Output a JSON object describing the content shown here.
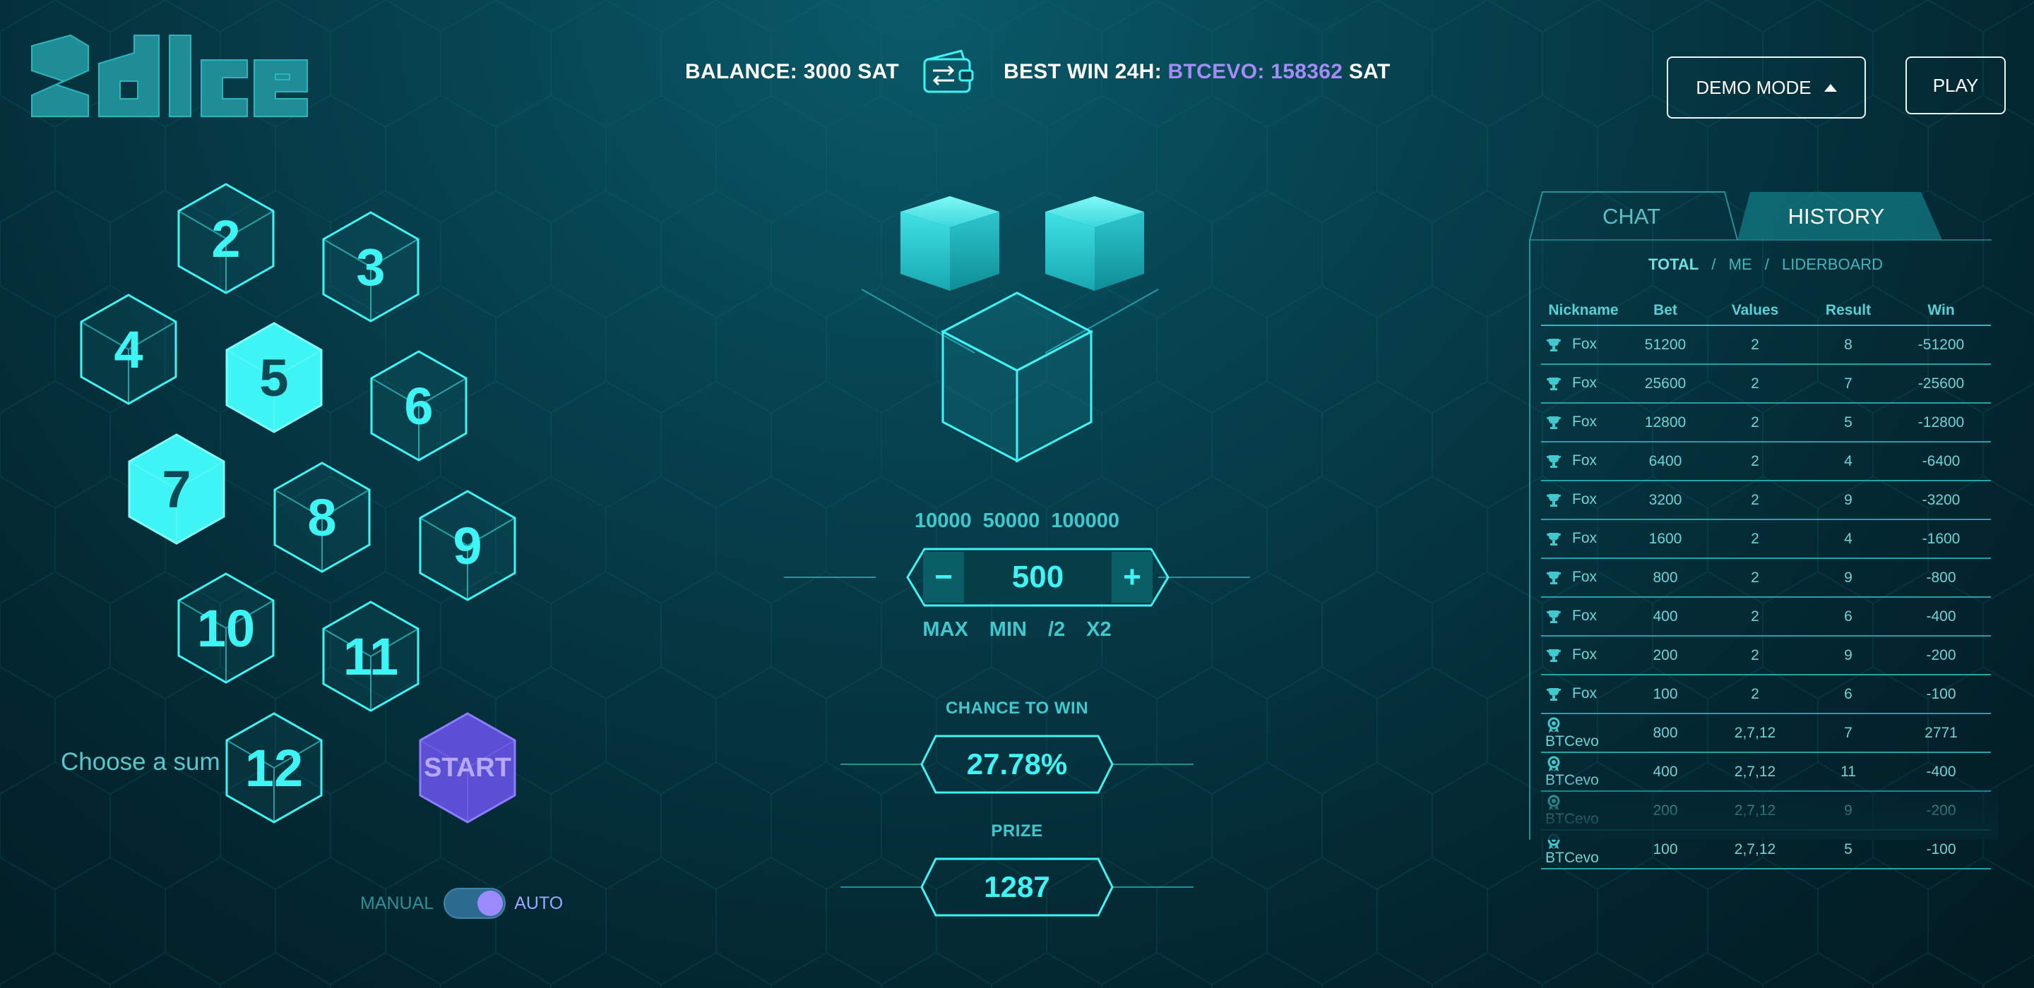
{
  "app": {
    "logo_text": "2dice"
  },
  "header": {
    "balance_label": "BALANCE:",
    "balance_value": "3000",
    "balance_unit": "SAT",
    "wallet_icon": "wallet-exchange-icon",
    "best_label": "BEST WIN 24H:",
    "best_user": "BTCEVO:",
    "best_value": "158362",
    "best_unit": "SAT",
    "demo_label": "DEMO MODE",
    "play_label": "PLAY"
  },
  "board": {
    "sums": [
      "2",
      "3",
      "4",
      "5",
      "6",
      "7",
      "8",
      "9",
      "10",
      "11",
      "12"
    ],
    "selected": [
      "5",
      "7"
    ],
    "start_label": "START",
    "choose_label": "Choose a sum",
    "toggle": {
      "left": "MANUAL",
      "right": "AUTO",
      "value": "AUTO"
    }
  },
  "bet": {
    "presets": [
      "10000",
      "50000",
      "100000"
    ],
    "minus": "−",
    "plus": "+",
    "value": "500",
    "modifiers": [
      "MAX",
      "MIN",
      "/2",
      "X2"
    ]
  },
  "chance": {
    "label": "CHANCE TO WIN",
    "value": "27.78%"
  },
  "prize": {
    "label": "PRIZE",
    "value": "1287"
  },
  "panel": {
    "tabs": [
      "CHAT",
      "HISTORY"
    ],
    "active_tab": "HISTORY",
    "subnav": [
      "TOTAL",
      "ME",
      "LIDERBOARD"
    ],
    "active_sub": "TOTAL",
    "columns": [
      "Nickname",
      "Bet",
      "Values",
      "Result",
      "Win"
    ],
    "rows": [
      {
        "icon": "trophy-icon",
        "nick": "Fox",
        "bet": "51200",
        "values": "2",
        "result": "8",
        "win": "-51200"
      },
      {
        "icon": "trophy-icon",
        "nick": "Fox",
        "bet": "25600",
        "values": "2",
        "result": "7",
        "win": "-25600"
      },
      {
        "icon": "trophy-icon",
        "nick": "Fox",
        "bet": "12800",
        "values": "2",
        "result": "5",
        "win": "-12800"
      },
      {
        "icon": "trophy-icon",
        "nick": "Fox",
        "bet": "6400",
        "values": "2",
        "result": "4",
        "win": "-6400"
      },
      {
        "icon": "trophy-icon",
        "nick": "Fox",
        "bet": "3200",
        "values": "2",
        "result": "9",
        "win": "-3200"
      },
      {
        "icon": "trophy-icon",
        "nick": "Fox",
        "bet": "1600",
        "values": "2",
        "result": "4",
        "win": "-1600"
      },
      {
        "icon": "trophy-icon",
        "nick": "Fox",
        "bet": "800",
        "values": "2",
        "result": "9",
        "win": "-800"
      },
      {
        "icon": "trophy-icon",
        "nick": "Fox",
        "bet": "400",
        "values": "2",
        "result": "6",
        "win": "-400"
      },
      {
        "icon": "trophy-icon",
        "nick": "Fox",
        "bet": "200",
        "values": "2",
        "result": "9",
        "win": "-200"
      },
      {
        "icon": "trophy-icon",
        "nick": "Fox",
        "bet": "100",
        "values": "2",
        "result": "6",
        "win": "-100"
      },
      {
        "icon": "medal-icon",
        "nick": "BTCevo",
        "bet": "800",
        "values": "2,7,12",
        "result": "7",
        "win": "2771"
      },
      {
        "icon": "medal-icon",
        "nick": "BTCevo",
        "bet": "400",
        "values": "2,7,12",
        "result": "11",
        "win": "-400"
      },
      {
        "icon": "medal-icon",
        "nick": "BTCevo",
        "bet": "200",
        "values": "2,7,12",
        "result": "9",
        "win": "-200"
      },
      {
        "icon": "medal-icon",
        "nick": "BTCevo",
        "bet": "100",
        "values": "2,7,12",
        "result": "5",
        "win": "-100"
      }
    ]
  },
  "colors": {
    "accent": "#3ff4f5",
    "purple": "#a38cf5",
    "background": "#063f4c"
  }
}
